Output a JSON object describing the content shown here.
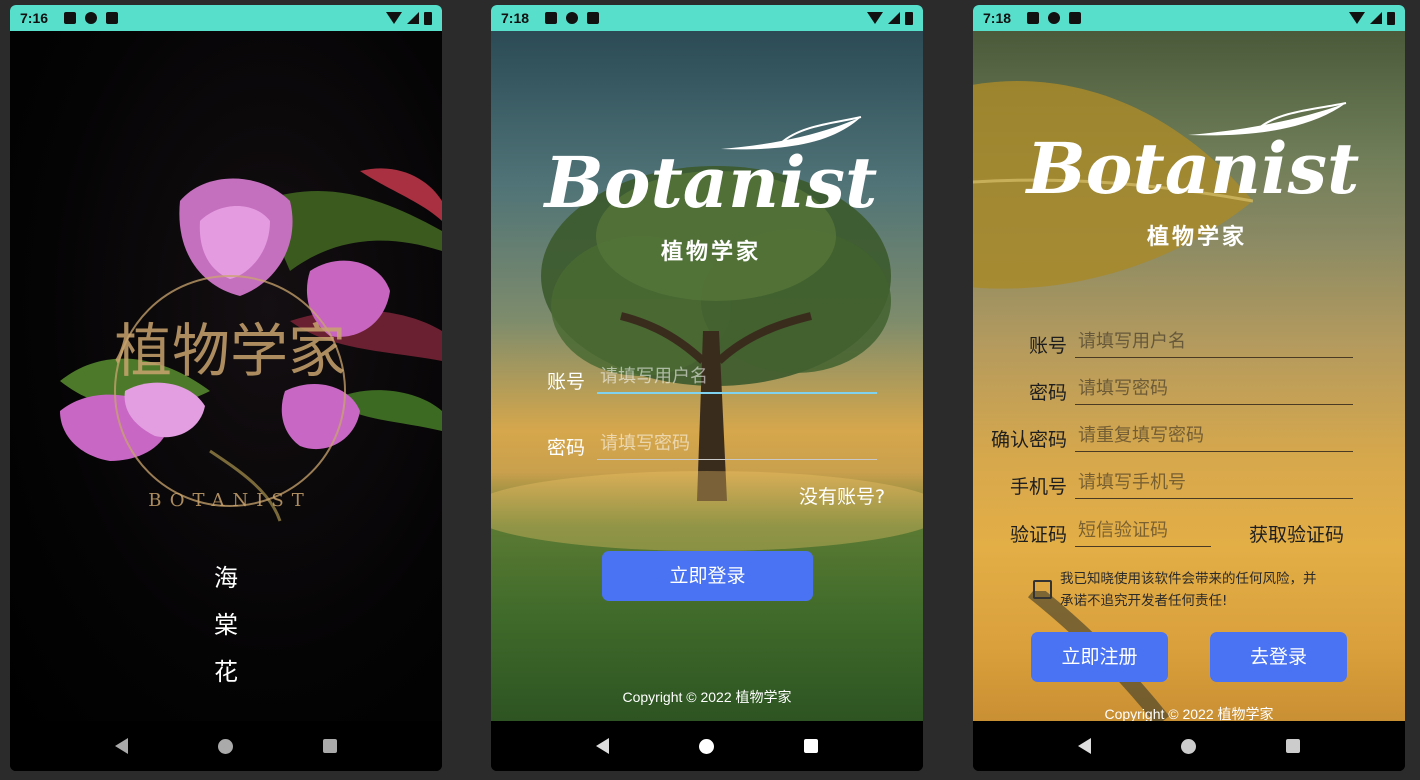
{
  "colors": {
    "statusbar": "#57dfcb",
    "primary_button": "#4a73f3",
    "active_underline": "#7fd3f0"
  },
  "status": {
    "time_1": "7:16",
    "time_2": "7:18",
    "time_3": "7:18",
    "icons": [
      "a-icon",
      "p-icon",
      "sd-card-icon",
      "wifi-icon",
      "signal-icon",
      "battery-icon"
    ]
  },
  "splash": {
    "logo_chars": "植物学家",
    "logo_ring_text": "BOTANIST",
    "chars": [
      "海",
      "棠",
      "花"
    ]
  },
  "login": {
    "logo_script": "Botanist",
    "logo_sub": "植物学家",
    "account_label": "账号",
    "account_placeholder": "请填写用户名",
    "password_label": "密码",
    "password_placeholder": "请填写密码",
    "no_account_link": "没有账号?",
    "login_button": "立即登录",
    "copyright": "Copyright © 2022 植物学家"
  },
  "register": {
    "logo_script": "Botanist",
    "logo_sub": "植物学家",
    "fields": [
      {
        "label": "账号",
        "placeholder": "请填写用户名"
      },
      {
        "label": "密码",
        "placeholder": "请填写密码"
      },
      {
        "label": "确认密码",
        "placeholder": "请重复填写密码"
      },
      {
        "label": "手机号",
        "placeholder": "请填写手机号"
      }
    ],
    "code_label": "验证码",
    "code_placeholder": "短信验证码",
    "get_code": "获取验证码",
    "agree_line1": "我已知晓使用该软件会带来的任何风险，并",
    "agree_line2": "承诺不追究开发者任何责任!",
    "register_button": "立即注册",
    "goto_login_button": "去登录",
    "copyright": "Copyright © 2022 植物学家"
  }
}
